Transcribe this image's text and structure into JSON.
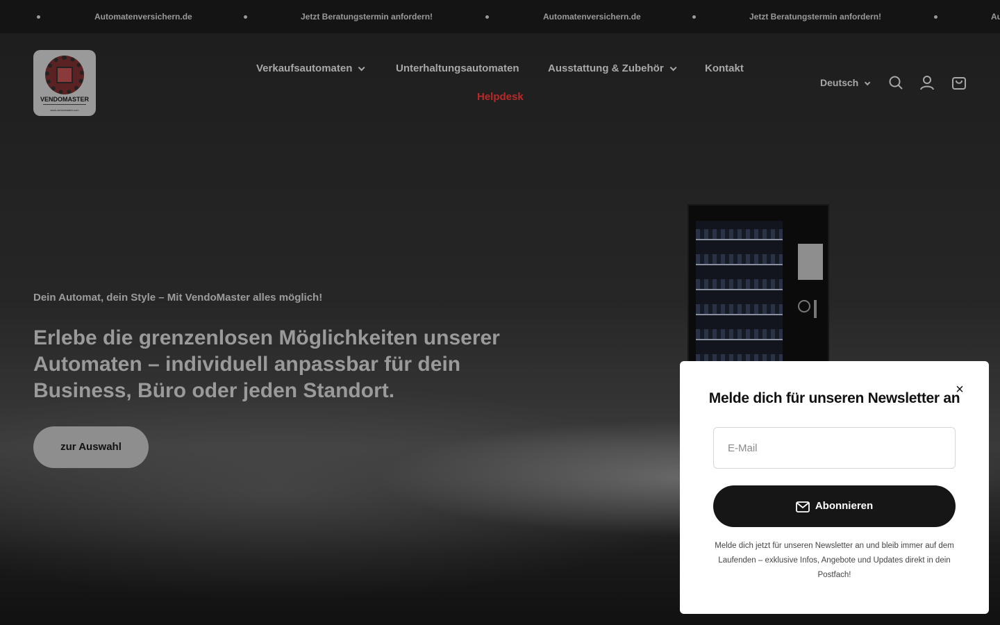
{
  "announcement": {
    "items": [
      "Automatenversichern.de",
      "Jetzt Beratungstermin anfordern!",
      "Automatenversichern.de",
      "Jetzt Beratungstermin anfordern!",
      "Au"
    ]
  },
  "header": {
    "logo": {
      "brand": "VENDOMASTER",
      "url_text": "www.vendomaster.com"
    },
    "nav": [
      {
        "label": "Verkaufsautomaten",
        "has_dropdown": true
      },
      {
        "label": "Unterhaltungsautomaten",
        "has_dropdown": false
      },
      {
        "label": "Ausstattung & Zubehör",
        "has_dropdown": true
      },
      {
        "label": "Kontakt",
        "has_dropdown": false
      },
      {
        "label": "Helpdesk",
        "has_dropdown": false
      }
    ],
    "language": "Deutsch",
    "icons": [
      "search-icon",
      "account-icon",
      "cart-icon"
    ]
  },
  "hero": {
    "tagline": "Dein Automat, dein Style – Mit VendoMaster alles möglich!",
    "headline": "Erlebe die grenzenlosen Möglichkeiten unserer Automaten – individuell anpassbar für dein Business, Büro oder jeden Standort.",
    "cta_label": "zur Auswahl"
  },
  "newsletter": {
    "title": "Melde dich für unseren Newsletter an",
    "close_label": "×",
    "email_placeholder": "E-Mail",
    "email_value": "",
    "button_label": "Abonnieren",
    "description": "Melde dich jetzt für unseren Newsletter an und bleib immer auf dem Laufenden – exklusive Infos, Angebote und Updates direkt in dein Postfach!"
  },
  "colors": {
    "accent_helpdesk": "#b82a2a",
    "modal_button": "#161616"
  }
}
